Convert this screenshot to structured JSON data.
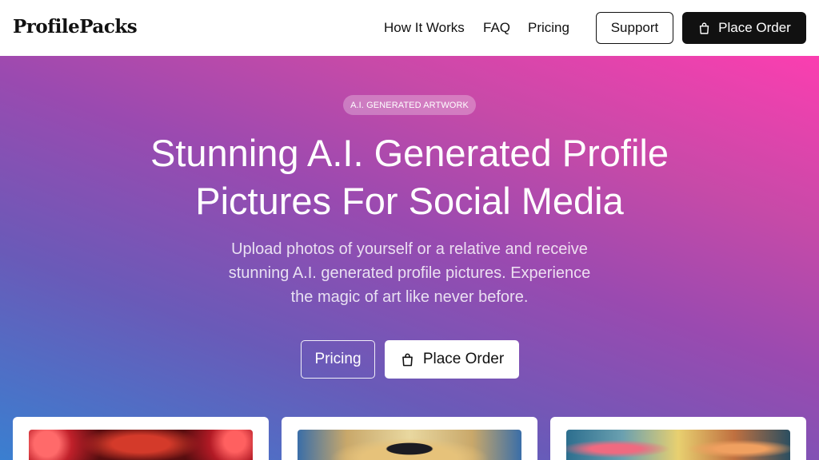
{
  "header": {
    "logo": "ProfilePacks",
    "nav": [
      {
        "label": "How It Works"
      },
      {
        "label": "FAQ"
      },
      {
        "label": "Pricing"
      }
    ],
    "support_label": "Support",
    "order_label": "Place Order"
  },
  "hero": {
    "badge": "A.I. GENERATED ARTWORK",
    "title_line1": "Stunning A.I. Generated Profile",
    "title_line2": "Pictures For Social Media",
    "subtitle_line1": "Upload photos of yourself or a relative and receive",
    "subtitle_line2": "stunning A.I. generated profile pictures. Experience",
    "subtitle_line3": "the magic of art like never before.",
    "pricing_label": "Pricing",
    "order_label": "Place Order"
  },
  "colors": {
    "gradient_start": "#3a7fd0",
    "gradient_end": "#fb3eb0",
    "dark": "#111111"
  },
  "icons": {
    "order": "shopping-bag-icon"
  }
}
